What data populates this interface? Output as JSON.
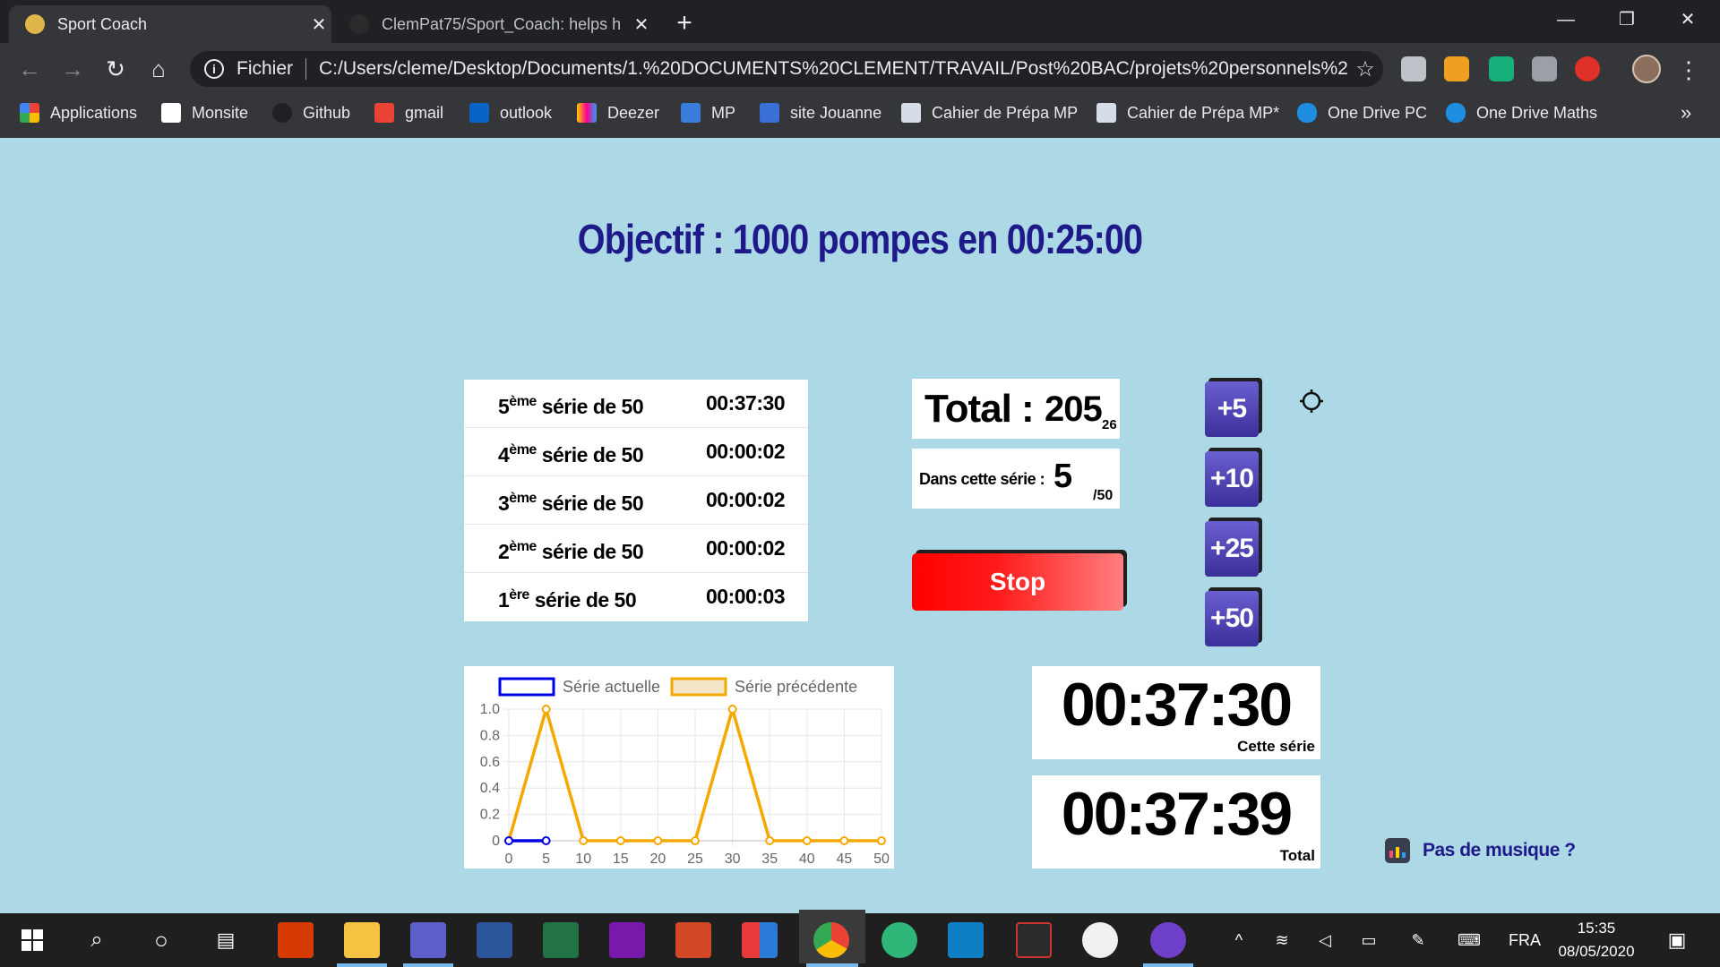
{
  "browser": {
    "tabs": [
      {
        "title": "Sport Coach",
        "active": true
      },
      {
        "title": "ClemPat75/Sport_Coach: helps h",
        "active": false
      }
    ],
    "address": {
      "protocol_label": "Fichier",
      "url": "C:/Users/cleme/Desktop/Documents/1.%20DOCUMENTS%20CLEMENT/TRAVAIL/Post%20BAC/projets%20personnels%20..."
    },
    "bookmarks": [
      "Applications",
      "Monsite",
      "Github",
      "gmail",
      "outlook",
      "Deezer",
      "MP",
      "site Jouanne",
      "Cahier de Prépa MP",
      "Cahier de Prépa MP*",
      "One Drive PC",
      "One Drive Maths"
    ],
    "icons": {
      "back": "arrow-left-icon",
      "forward": "arrow-right-icon",
      "reload": "reload-icon",
      "home": "home-icon",
      "bookmark_star": "star-icon",
      "menu": "kebab-menu-icon"
    }
  },
  "page": {
    "objective": "Objectif : 1000 pompes en 00:25:00",
    "series": [
      {
        "num": "5",
        "sup": "ème",
        "label": " série de 50",
        "time": "00:37:30"
      },
      {
        "num": "4",
        "sup": "ème",
        "label": " série de 50",
        "time": "00:00:02"
      },
      {
        "num": "3",
        "sup": "ème",
        "label": " série de 50",
        "time": "00:00:02"
      },
      {
        "num": "2",
        "sup": "ème",
        "label": " série de 50",
        "time": "00:00:02"
      },
      {
        "num": "1",
        "sup": "ère",
        "label": " série de 50",
        "time": "00:00:03"
      }
    ],
    "total": {
      "label": "Total :",
      "value": "205",
      "sub": "26"
    },
    "current_series": {
      "label": "Dans cette série :",
      "value": "5",
      "of": "/50"
    },
    "stop_label": "Stop",
    "plus_buttons": [
      "+5",
      "+10",
      "+25",
      "+50"
    ],
    "timer_series": {
      "value": "00:37:30",
      "caption": "Cette série"
    },
    "timer_total": {
      "value": "00:37:39",
      "caption": "Total"
    },
    "music_link": "Pas de musique ?",
    "colors": {
      "title": "#1f1a8a",
      "stop": "#ff0000",
      "plus": "#4a3fb5",
      "current_series_line": "#0000e6",
      "previous_series_line": "#f5a800"
    }
  },
  "chart_data": {
    "type": "line",
    "x": [
      0,
      5,
      10,
      15,
      20,
      25,
      30,
      35,
      40,
      45,
      50
    ],
    "series": [
      {
        "name": "Série actuelle",
        "x": [
          0,
          5
        ],
        "values": [
          0,
          0
        ]
      },
      {
        "name": "Série précédente",
        "x": [
          0,
          5,
          10,
          15,
          20,
          25,
          30,
          35,
          40,
          45,
          50
        ],
        "values": [
          0,
          1,
          0,
          0,
          0,
          0,
          1,
          0,
          0,
          0,
          0
        ]
      }
    ],
    "yticks": [
      "0",
      "0.2",
      "0.4",
      "0.6",
      "0.8",
      "1.0"
    ],
    "xticks": [
      "0",
      "5",
      "10",
      "15",
      "20",
      "25",
      "30",
      "35",
      "40",
      "45",
      "50"
    ],
    "ylim": [
      0,
      1
    ],
    "xlim": [
      0,
      50
    ],
    "grid": true,
    "legend": "top"
  },
  "taskbar": {
    "lang": "FRA",
    "time": "15:35",
    "date": "08/05/2020"
  }
}
